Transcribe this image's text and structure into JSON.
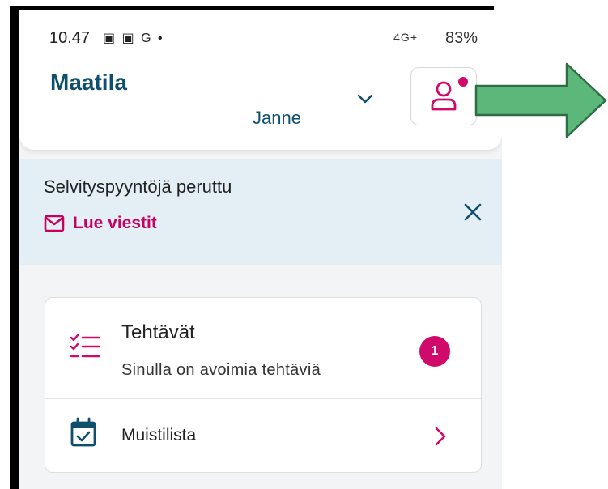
{
  "status_bar": {
    "time": "10.47",
    "left_icons": "▣ ▣ G •",
    "signal": "4G+",
    "battery": "83%"
  },
  "header": {
    "title": "Maatila",
    "user": "Janne"
  },
  "banner": {
    "title": "Selvityspyyntöjä peruttu",
    "link_label": "Lue viestit"
  },
  "card": {
    "tasks": {
      "title": "Tehtävät",
      "subtitle": "Sinulla on avoimia tehtäviä",
      "badge_count": "1"
    },
    "memo": {
      "label": "Muistilista"
    }
  },
  "colors": {
    "brand": "#0f4f6e",
    "accent": "#d00a6b",
    "banner_bg": "#e4eff5",
    "arrow": "#5bb87a"
  },
  "icons": [
    "chevron-down-icon",
    "user-icon",
    "mail-icon",
    "close-icon",
    "checklist-icon",
    "calendar-check-icon",
    "chevron-right-icon",
    "arrow-right-icon"
  ]
}
